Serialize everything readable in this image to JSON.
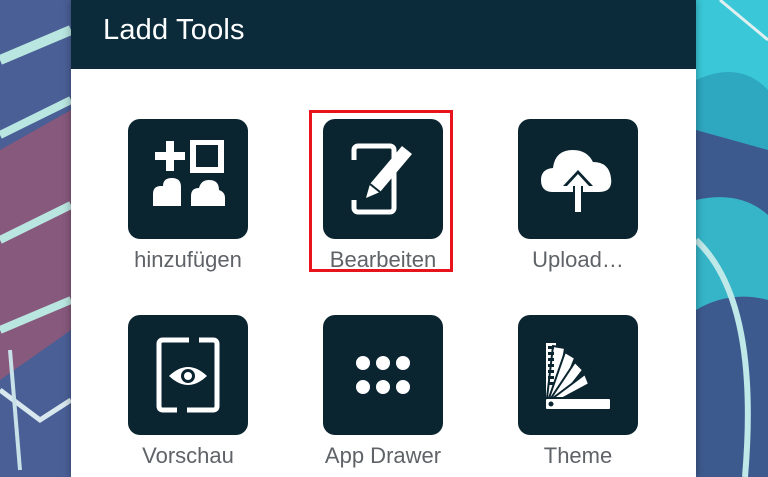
{
  "dialog": {
    "title": "Ladd Tools"
  },
  "tools": [
    {
      "label": "hinzufügen",
      "icon": "add-widgets-icon"
    },
    {
      "label": "Bearbeiten",
      "icon": "edit-icon"
    },
    {
      "label": "Upload…",
      "icon": "cloud-upload-icon"
    },
    {
      "label": "Vorschau",
      "icon": "preview-icon"
    },
    {
      "label": "App Drawer",
      "icon": "app-drawer-icon"
    },
    {
      "label": "Theme",
      "icon": "color-swatch-icon"
    }
  ],
  "colors": {
    "header": "#0b2b3a",
    "tile": "#0b2530",
    "highlight": "#e8141c",
    "label": "#5f6368"
  }
}
